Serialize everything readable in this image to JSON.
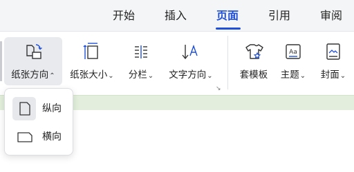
{
  "tabs": [
    {
      "label": "开始"
    },
    {
      "label": "插入"
    },
    {
      "label": "页面",
      "active": true
    },
    {
      "label": "引用"
    },
    {
      "label": "审阅"
    }
  ],
  "ribbon": {
    "paper_orientation": {
      "label": "纸张方向",
      "icon": "page-orientation-icon",
      "expanded": true
    },
    "paper_size": {
      "label": "纸张大小",
      "icon": "paper-size-icon"
    },
    "columns": {
      "label": "分栏",
      "icon": "columns-icon"
    },
    "text_direction": {
      "label": "文字方向",
      "icon": "text-direction-icon"
    },
    "templates": {
      "label": "套模板",
      "icon": "template-shirt-icon"
    },
    "theme": {
      "label": "主题",
      "icon": "theme-icon"
    },
    "cover": {
      "label": "封面",
      "icon": "cover-page-icon"
    }
  },
  "orientation_menu": {
    "items": [
      {
        "label": "纵向",
        "icon": "portrait-page-icon",
        "selected": true
      },
      {
        "label": "横向",
        "icon": "landscape-page-icon",
        "selected": false
      }
    ]
  },
  "colors": {
    "accent": "#1f4fd6",
    "ribbon_bg": "#ffffff",
    "tabbar_bg": "#f4f5f7",
    "doc_strip": "#e3efdc"
  }
}
